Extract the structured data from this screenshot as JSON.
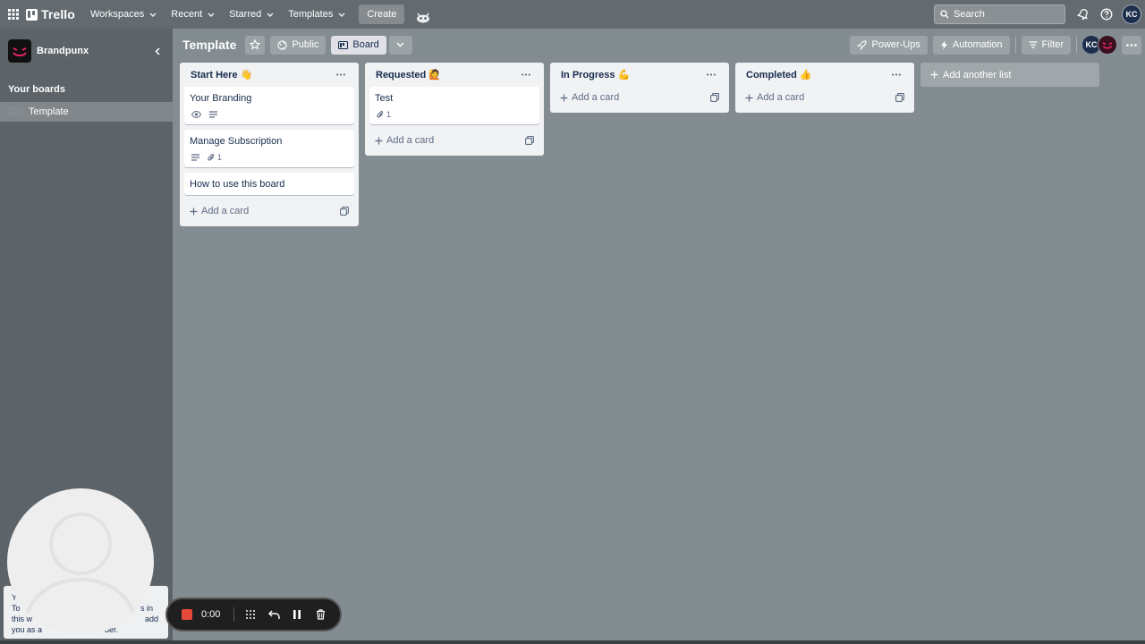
{
  "topbar": {
    "logo": "Trello",
    "menus": [
      "Workspaces",
      "Recent",
      "Starred",
      "Templates"
    ],
    "create_label": "Create",
    "search_placeholder": "Search",
    "user_initials": "KC"
  },
  "sidebar": {
    "workspace_name": "Brandpunx",
    "section_title": "Your boards",
    "boards": [
      {
        "name": "Template"
      }
    ]
  },
  "board": {
    "title": "Template",
    "visibility_label": "Public",
    "view_label": "Board",
    "powerups_label": "Power-Ups",
    "automation_label": "Automation",
    "filter_label": "Filter",
    "member_initials": "KC",
    "add_list_label": "Add another list"
  },
  "lists": [
    {
      "title": "Start Here 👋",
      "cards": [
        {
          "title": "Your Branding",
          "watch": true,
          "description": true
        },
        {
          "title": "Manage Subscription",
          "description": true,
          "attachments": "1"
        },
        {
          "title": "How to use this board"
        }
      ],
      "add_card_label": "Add a card"
    },
    {
      "title": "Requested 🙋",
      "cards": [
        {
          "title": "Test",
          "attachments": "1"
        }
      ],
      "add_card_label": "Add a card"
    },
    {
      "title": "In Progress 💪",
      "cards": [],
      "add_card_label": "Add a card"
    },
    {
      "title": "Completed 👍",
      "cards": [],
      "add_card_label": "Add a card"
    }
  ],
  "overlay": {
    "toast_lines": [
      "Y",
      "To",
      "s in",
      "this w",
      "add",
      "you as a",
      "ber."
    ],
    "recorder_time": "0:00"
  },
  "colors": {
    "board_bg": "#838c91",
    "topbar_bg": "#636b70",
    "sidebar_bg": "#5d6469",
    "list_bg": "#f1f2f4",
    "recorder_dot": "#e5493a"
  }
}
